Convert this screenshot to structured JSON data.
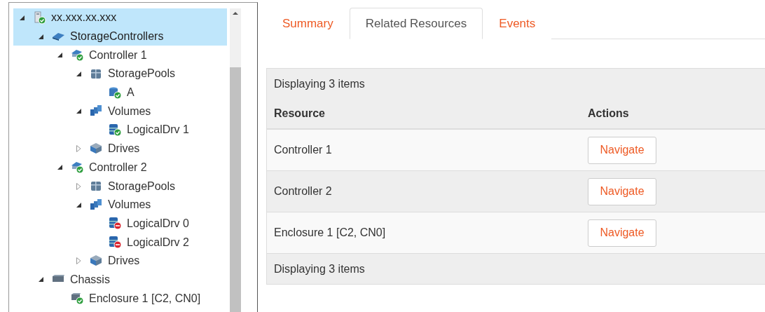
{
  "tree": {
    "items": [
      {
        "label": "xx.xxx.xx.xxx",
        "kind": "server",
        "error": false,
        "expanded": true,
        "selected": true,
        "children": [
          {
            "label": "StorageControllers",
            "kind": "board",
            "expanded": true,
            "selected": true,
            "children": [
              {
                "label": "Controller 1",
                "kind": "controller",
                "error": false,
                "expanded": true,
                "selected": false,
                "children": [
                  {
                    "label": "StoragePools",
                    "kind": "pools",
                    "expanded": true,
                    "selected": false,
                    "children": [
                      {
                        "label": "A",
                        "kind": "pool",
                        "error": false,
                        "selected": false
                      }
                    ]
                  },
                  {
                    "label": "Volumes",
                    "kind": "volumes",
                    "expanded": true,
                    "selected": false,
                    "children": [
                      {
                        "label": "LogicalDrv 1",
                        "kind": "volume",
                        "error": false,
                        "selected": false
                      }
                    ]
                  },
                  {
                    "label": "Drives",
                    "kind": "drives",
                    "expanded": false,
                    "selected": false
                  }
                ]
              },
              {
                "label": "Controller 2",
                "kind": "controller",
                "error": false,
                "expanded": true,
                "selected": false,
                "children": [
                  {
                    "label": "StoragePools",
                    "kind": "pools",
                    "expanded": false,
                    "selected": false
                  },
                  {
                    "label": "Volumes",
                    "kind": "volumes",
                    "expanded": true,
                    "selected": false,
                    "children": [
                      {
                        "label": "LogicalDrv 0",
                        "kind": "volume",
                        "error": true,
                        "selected": false
                      },
                      {
                        "label": "LogicalDrv 2",
                        "kind": "volume",
                        "error": true,
                        "selected": false
                      }
                    ]
                  },
                  {
                    "label": "Drives",
                    "kind": "drives",
                    "expanded": false,
                    "selected": false
                  }
                ]
              }
            ]
          },
          {
            "label": "Chassis",
            "kind": "chassis",
            "expanded": true,
            "selected": false,
            "children": [
              {
                "label": "Enclosure 1 [C2, CN0]",
                "kind": "enclosure",
                "error": false,
                "selected": false
              }
            ]
          }
        ]
      }
    ]
  },
  "tabs": [
    {
      "label": "Summary",
      "selected": false
    },
    {
      "label": "Related Resources",
      "selected": true
    },
    {
      "label": "Events",
      "selected": false
    }
  ],
  "table": {
    "summary_top": "Displaying 3 items",
    "columns": [
      "Resource",
      "Actions"
    ],
    "rows": [
      {
        "resource": "Controller 1",
        "action": "Navigate"
      },
      {
        "resource": "Controller 2",
        "action": "Navigate"
      },
      {
        "resource": "Enclosure 1 [C2, CN0]",
        "action": "Navigate"
      }
    ],
    "summary_bottom": "Displaying 3 items"
  }
}
